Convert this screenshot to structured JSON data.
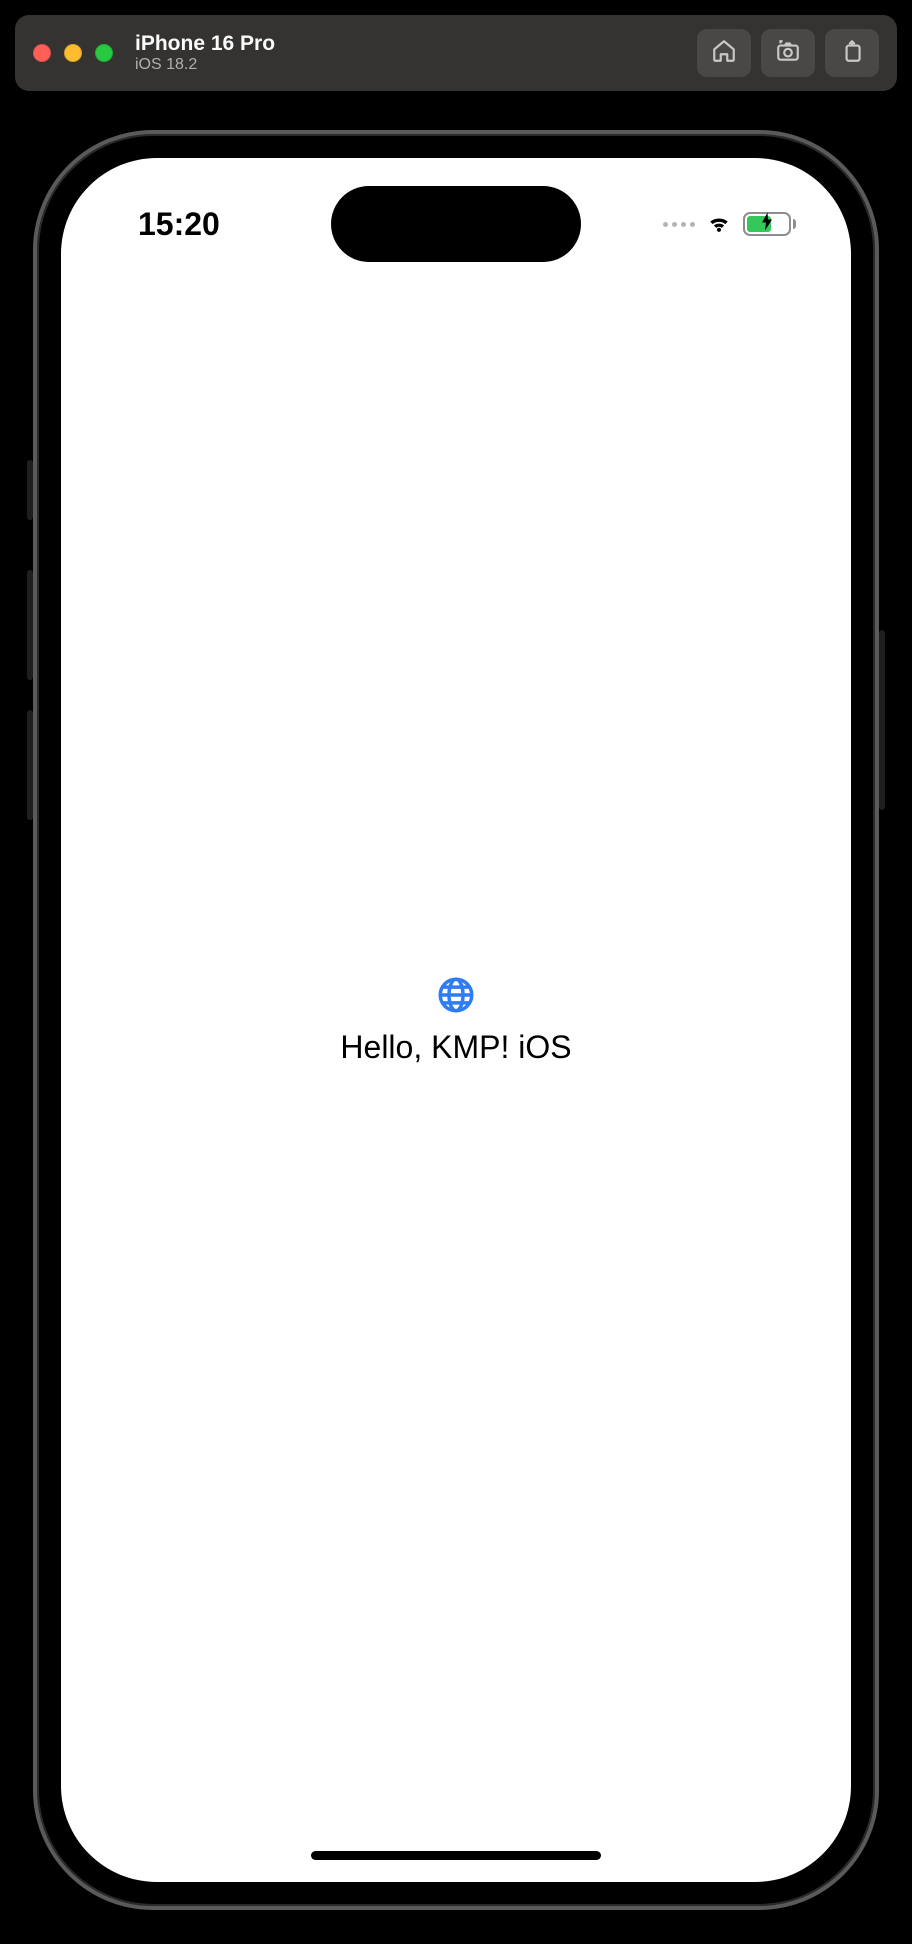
{
  "simulator": {
    "title": "iPhone 16 Pro",
    "subtitle": "iOS 18.2"
  },
  "statusBar": {
    "time": "15:20"
  },
  "content": {
    "greeting": "Hello, KMP! iOS"
  },
  "colors": {
    "accent": "#2e7cf6",
    "batteryFill": "#34c759"
  }
}
